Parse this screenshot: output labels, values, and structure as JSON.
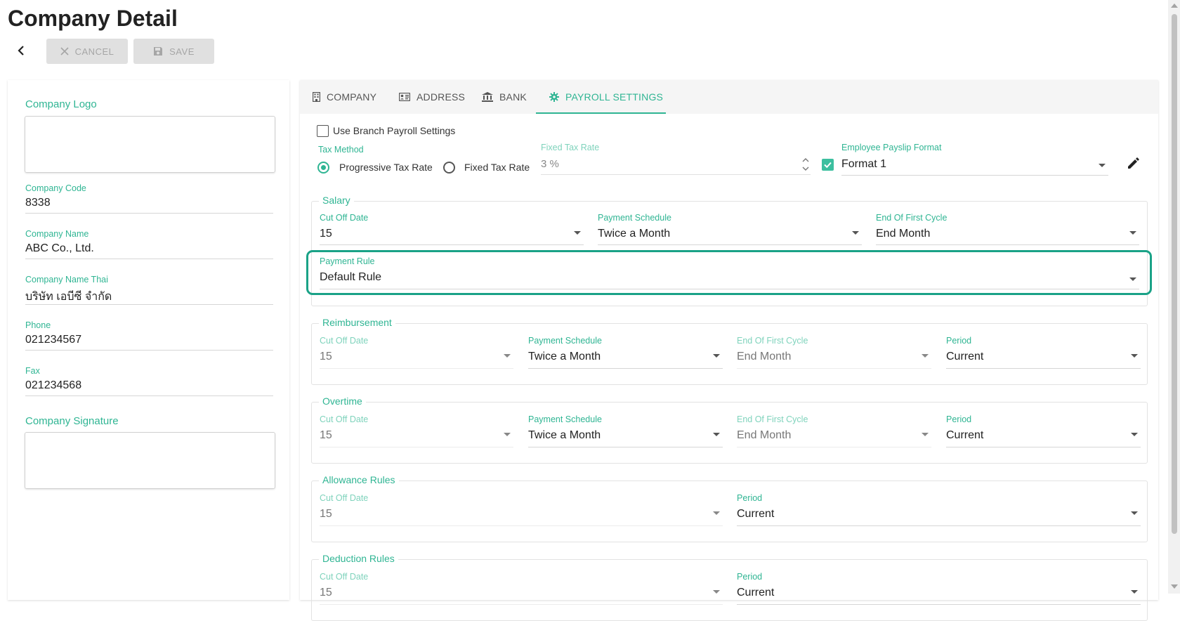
{
  "page": {
    "title": "Company Detail"
  },
  "toolbar": {
    "cancel_label": "CANCEL",
    "save_label": "SAVE"
  },
  "company": {
    "logo_label": "Company Logo",
    "signature_label": "Company Signature",
    "fields": {
      "code": {
        "label": "Company Code",
        "value": "8338"
      },
      "name": {
        "label": "Company Name",
        "value": "ABC Co., Ltd."
      },
      "name_thai": {
        "label": "Company Name Thai",
        "value": "บริษัท เอบีซี จำกัด"
      },
      "phone": {
        "label": "Phone",
        "value": "021234567"
      },
      "fax": {
        "label": "Fax",
        "value": "021234568"
      }
    }
  },
  "tabs": [
    {
      "label": "COMPANY",
      "icon": "building-icon"
    },
    {
      "label": "ADDRESS",
      "icon": "address-card-icon"
    },
    {
      "label": "BANK",
      "icon": "bank-icon"
    },
    {
      "label": "PAYROLL SETTINGS",
      "icon": "gear-icon",
      "active": true
    }
  ],
  "payroll": {
    "use_branch_label": "Use Branch Payroll Settings",
    "use_branch_checked": false,
    "tax_method": {
      "label": "Tax Method",
      "options": [
        "Progressive Tax Rate",
        "Fixed Tax Rate"
      ],
      "selected": "Progressive Tax Rate"
    },
    "fixed_tax_rate": {
      "label": "Fixed Tax Rate",
      "value": "3 %"
    },
    "payslip": {
      "label": "Employee Payslip Format",
      "value": "Format 1",
      "checked": true
    },
    "salary": {
      "legend": "Salary",
      "cutoff": {
        "label": "Cut Off Date",
        "value": "15"
      },
      "schedule": {
        "label": "Payment Schedule",
        "value": "Twice a Month"
      },
      "end_first": {
        "label": "End Of First Cycle",
        "value": "End Month"
      },
      "rule": {
        "label": "Payment Rule",
        "value": "Default Rule"
      }
    },
    "reimbursement": {
      "legend": "Reimbursement",
      "cutoff": {
        "label": "Cut Off Date",
        "value": "15"
      },
      "schedule": {
        "label": "Payment Schedule",
        "value": "Twice a Month"
      },
      "end_first": {
        "label": "End Of First Cycle",
        "value": "End Month"
      },
      "period": {
        "label": "Period",
        "value": "Current"
      }
    },
    "overtime": {
      "legend": "Overtime",
      "cutoff": {
        "label": "Cut Off Date",
        "value": "15"
      },
      "schedule": {
        "label": "Payment Schedule",
        "value": "Twice a Month"
      },
      "end_first": {
        "label": "End Of First Cycle",
        "value": "End Month"
      },
      "period": {
        "label": "Period",
        "value": "Current"
      }
    },
    "allowance": {
      "legend": "Allowance Rules",
      "cutoff": {
        "label": "Cut Off Date",
        "value": "15"
      },
      "period": {
        "label": "Period",
        "value": "Current"
      }
    },
    "deduction": {
      "legend": "Deduction Rules",
      "cutoff": {
        "label": "Cut Off Date",
        "value": "15"
      },
      "period": {
        "label": "Period",
        "value": "Current"
      }
    }
  },
  "colors": {
    "accent": "#2fb593",
    "highlight": "#1aa287"
  }
}
